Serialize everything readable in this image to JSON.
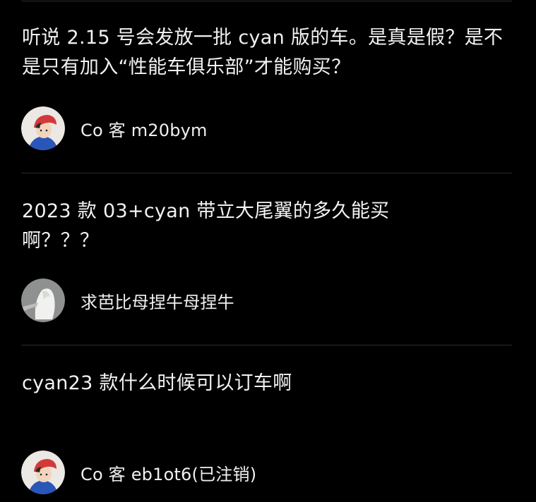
{
  "posts": [
    {
      "question": "听说 2.15 号会发放一批 cyan 版的车。是真是假？是不是只有加入“性能车俱乐部”才能购买？",
      "user": {
        "name": "Co 客 m20bym",
        "avatar": "red-hat-boy-avatar"
      }
    },
    {
      "question": "2023 款 03+cyan 带立大尾翼的多久能买啊？？？",
      "user": {
        "name": "求芭比母捏牛母捏牛",
        "avatar": "white-hood-avatar"
      }
    },
    {
      "question": "cyan23 款什么时候可以订车啊",
      "user": {
        "name": "Co 客 eb1ot6(已注销)",
        "avatar": "red-hat-boy-avatar"
      }
    }
  ],
  "colors": {
    "background": "#000000",
    "text": "#f2f2f2",
    "divider": "#2a2a2a",
    "avatar_hat": "#d23a3a",
    "avatar_shirt": "#2a56b8"
  }
}
